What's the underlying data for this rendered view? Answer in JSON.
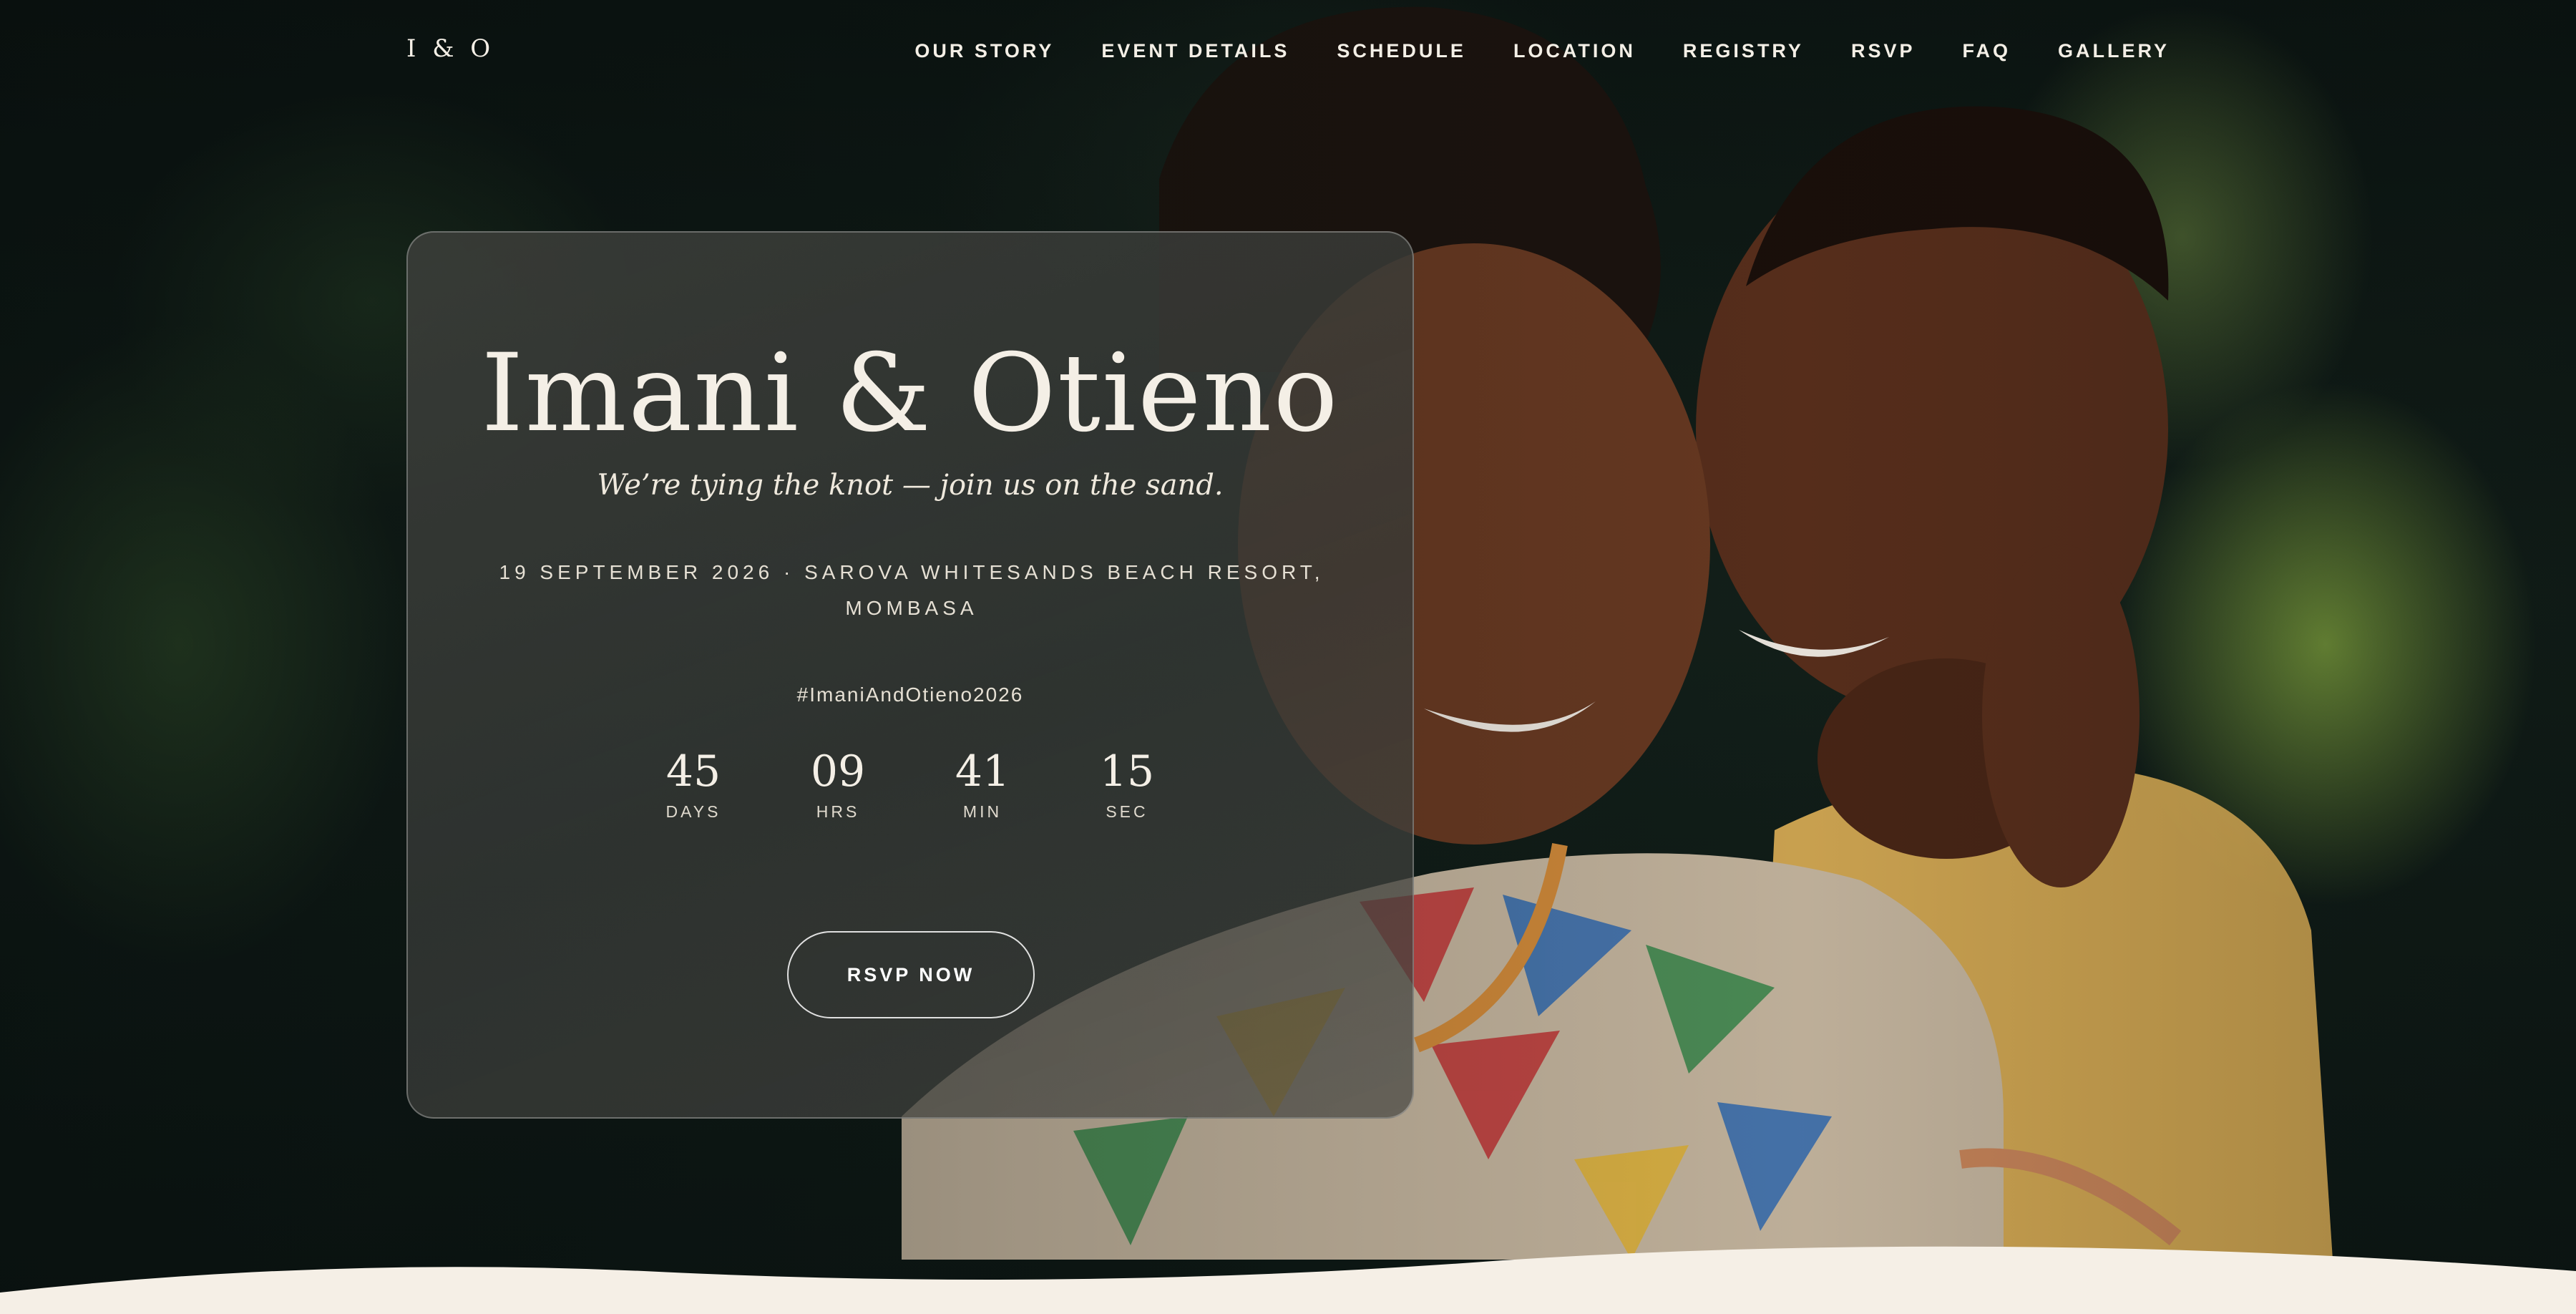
{
  "nav": {
    "monogram": "I & O",
    "items": [
      {
        "label": "OUR STORY"
      },
      {
        "label": "EVENT DETAILS"
      },
      {
        "label": "SCHEDULE"
      },
      {
        "label": "LOCATION"
      },
      {
        "label": "REGISTRY"
      },
      {
        "label": "RSVP"
      },
      {
        "label": "FAQ"
      },
      {
        "label": "GALLERY"
      }
    ]
  },
  "hero": {
    "names": "Imani & Otieno",
    "tagline": "We’re tying the knot — join us on the sand.",
    "details": "19 SEPTEMBER 2026 · SAROVA WHITESANDS BEACH RESORT, MOMBASA",
    "hashtag": "#ImaniAndOtieno2026",
    "countdown": [
      {
        "value": "45",
        "label": "DAYS"
      },
      {
        "value": "09",
        "label": "HRS"
      },
      {
        "value": "41",
        "label": "MIN"
      },
      {
        "value": "15",
        "label": "SEC"
      }
    ],
    "cta_label": "RSVP NOW"
  },
  "colors": {
    "text_light": "#f4efe6",
    "section_cream": "#f5efe6",
    "foliage_dark": "#0d1714"
  }
}
